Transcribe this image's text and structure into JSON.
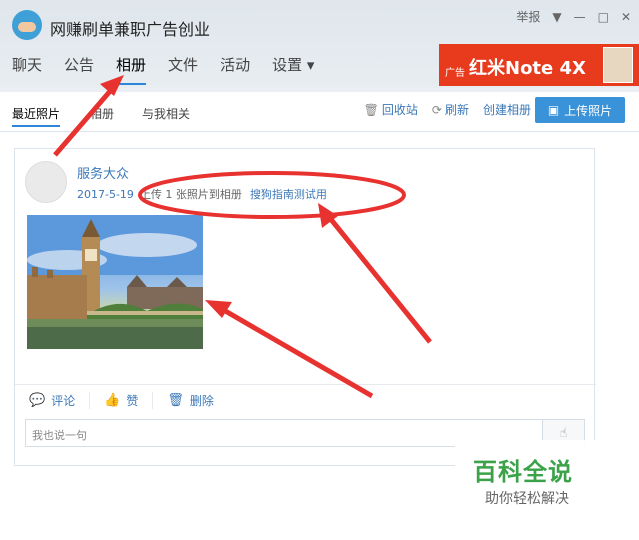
{
  "window": {
    "title": "网赚刷单兼职广告创业",
    "report_label": "举报",
    "dropdown_icon": "▼",
    "minimize_icon": "—",
    "maximize_icon": "□",
    "close_icon": "✕"
  },
  "tabs": [
    {
      "label": "聊天"
    },
    {
      "label": "公告"
    },
    {
      "label": "相册"
    },
    {
      "label": "文件"
    },
    {
      "label": "活动"
    },
    {
      "label": "设置 ▾"
    }
  ],
  "ad": {
    "tag": "广告",
    "text": "红米Note 4X"
  },
  "subnav": {
    "tabs": [
      {
        "label": "最近照片"
      },
      {
        "label": "相册"
      },
      {
        "label": "与我相关"
      }
    ],
    "recycle": "回收站",
    "refresh": "刷新",
    "create_album": "创建相册",
    "upload": "上传照片"
  },
  "post": {
    "user": "服务大众",
    "date": "2017-5-19",
    "text": "上传 1 张照片到相册",
    "album": "搜狗指南测试用"
  },
  "actions": {
    "comment": "评论",
    "like": "赞",
    "delete": "删除"
  },
  "reply": {
    "placeholder": "我也说一句"
  },
  "watermark": {
    "title": "百科全说",
    "subtitle": "助你轻松解决"
  },
  "colors": {
    "accent": "#2e86d8",
    "link": "#3b78b8",
    "annotation": "#e8322f",
    "ad": "#e83a1c",
    "watermark": "#3ca24a"
  }
}
